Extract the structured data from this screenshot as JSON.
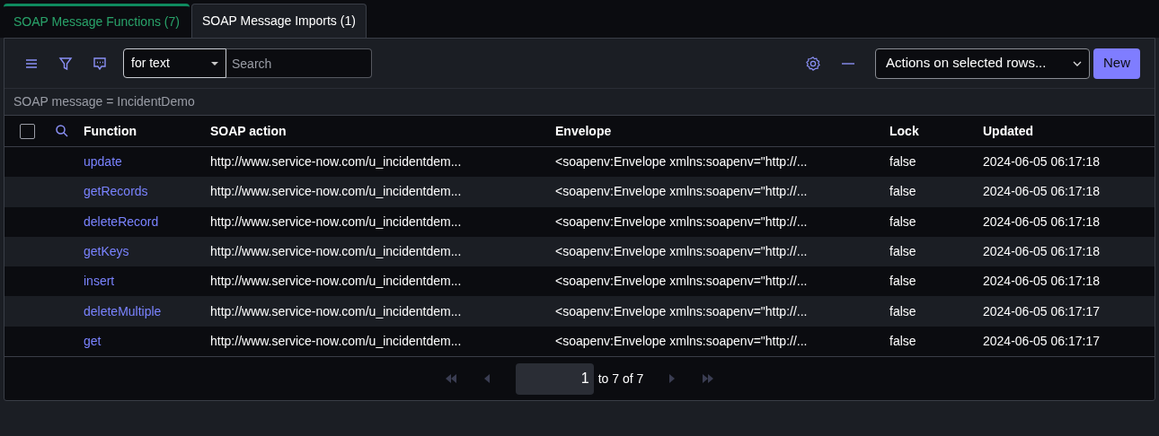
{
  "tabs": [
    {
      "label": "SOAP Message Functions (7)",
      "selected": true
    },
    {
      "label": "SOAP Message Imports (1)",
      "selected": false
    }
  ],
  "toolbar": {
    "search_type": "for text",
    "search": {
      "placeholder": "Search"
    },
    "actions": "Actions on selected rows...",
    "new_button": "New"
  },
  "filter": "SOAP message = IncidentDemo",
  "table": {
    "select_all": {
      "checked": false
    },
    "columns": [
      "Function",
      "SOAP action",
      "Envelope",
      "Lock",
      "Updated"
    ],
    "rows": [
      {
        "function": "update",
        "soap_action": "http://www.service-now.com/u_incidentdem...",
        "envelope": "<soapenv:Envelope xmlns:soapenv=\"http://...",
        "lock": "false",
        "updated": "2024-06-05 06:17:18"
      },
      {
        "function": "getRecords",
        "soap_action": "http://www.service-now.com/u_incidentdem...",
        "envelope": "<soapenv:Envelope xmlns:soapenv=\"http://...",
        "lock": "false",
        "updated": "2024-06-05 06:17:18"
      },
      {
        "function": "deleteRecord",
        "soap_action": "http://www.service-now.com/u_incidentdem...",
        "envelope": "<soapenv:Envelope xmlns:soapenv=\"http://...",
        "lock": "false",
        "updated": "2024-06-05 06:17:18"
      },
      {
        "function": "getKeys",
        "soap_action": "http://www.service-now.com/u_incidentdem...",
        "envelope": "<soapenv:Envelope xmlns:soapenv=\"http://...",
        "lock": "false",
        "updated": "2024-06-05 06:17:18"
      },
      {
        "function": "insert",
        "soap_action": "http://www.service-now.com/u_incidentdem...",
        "envelope": "<soapenv:Envelope xmlns:soapenv=\"http://...",
        "lock": "false",
        "updated": "2024-06-05 06:17:18"
      },
      {
        "function": "deleteMultiple",
        "soap_action": "http://www.service-now.com/u_incidentdem...",
        "envelope": "<soapenv:Envelope xmlns:soapenv=\"http://...",
        "lock": "false",
        "updated": "2024-06-05 06:17:17"
      },
      {
        "function": "get",
        "soap_action": "http://www.service-now.com/u_incidentdem...",
        "envelope": "<soapenv:Envelope xmlns:soapenv=\"http://...",
        "lock": "false",
        "updated": "2024-06-05 06:17:17"
      }
    ]
  },
  "pagination": {
    "page": "1",
    "range": "to 7 of 7",
    "first_disabled": true,
    "prev_disabled": true,
    "next_disabled": true,
    "last_disabled": true
  }
}
